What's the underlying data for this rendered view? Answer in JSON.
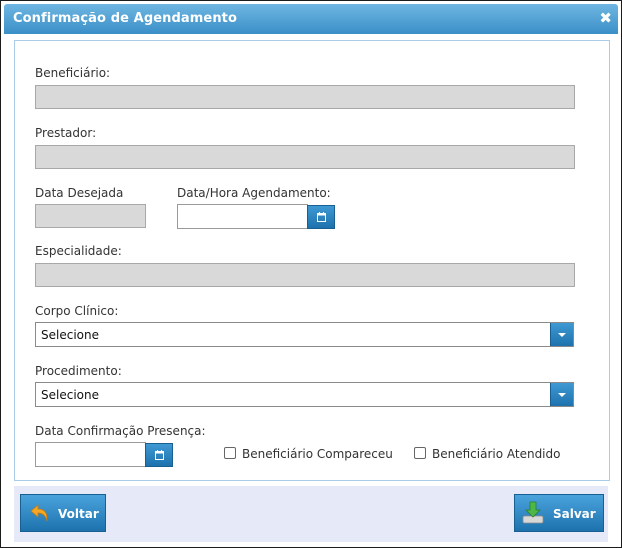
{
  "dialog": {
    "title": "Confirmação de Agendamento",
    "close_glyph": "✖"
  },
  "form": {
    "beneficiario_label": "Beneficiário:",
    "prestador_label": "Prestador:",
    "data_desejada_label": "Data Desejada",
    "data_hora_label": "Data/Hora Agendamento:",
    "especialidade_label": "Especialidade:",
    "corpo_clinico_label": "Corpo Clínico:",
    "corpo_clinico_value": "Selecione",
    "procedimento_label": "Procedimento:",
    "procedimento_value": "Selecione",
    "data_confirmacao_label": "Data Confirmação Presença:",
    "compareceu_label": "Beneficiário Compareceu",
    "atendido_label": "Beneficiário Atendido"
  },
  "footer": {
    "voltar_label": "Voltar",
    "salvar_label": "Salvar"
  },
  "colors": {
    "accent": "#2a86c5",
    "readonly_bg": "#d9d9d9",
    "footer_bg": "#e6e9f8"
  },
  "icons": {
    "close": "close-icon",
    "calendar": "calendar-icon",
    "back": "back-arrow-icon",
    "save": "save-download-icon",
    "dropdown": "chevron-down-icon"
  }
}
